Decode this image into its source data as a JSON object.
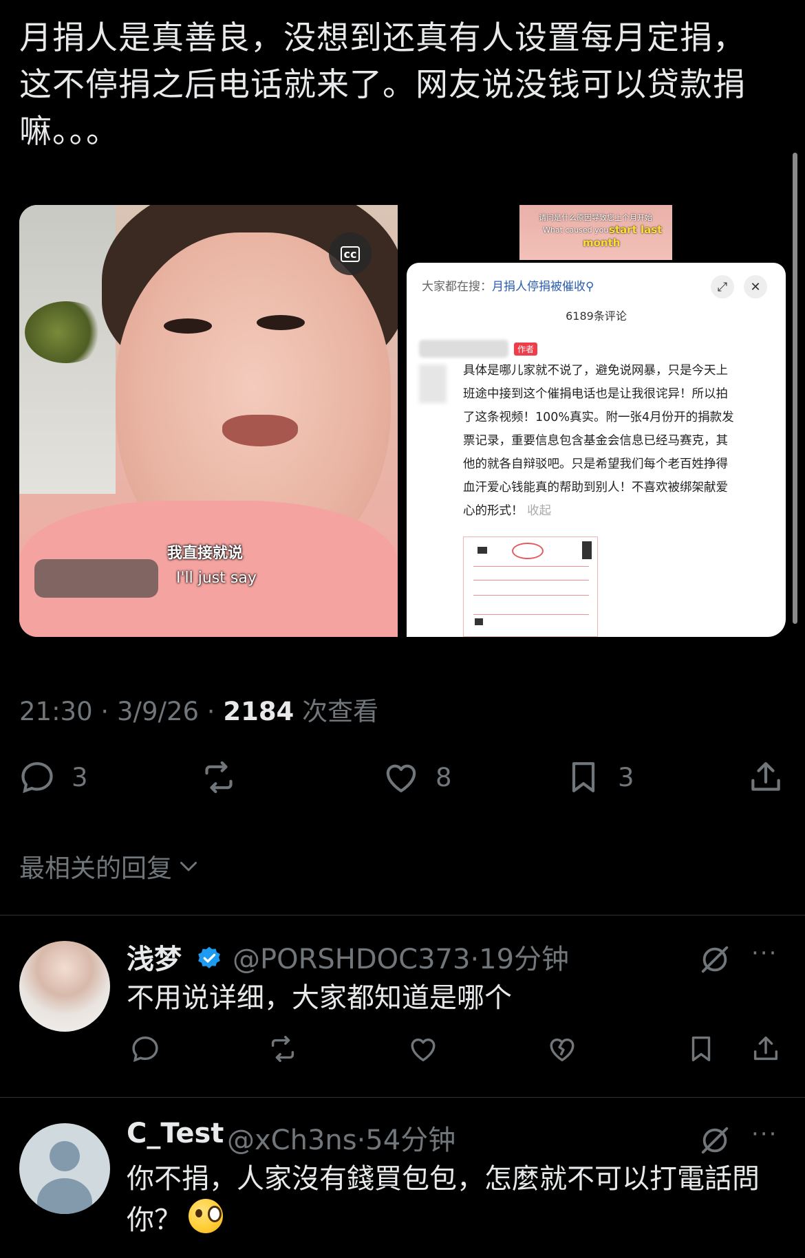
{
  "tweet": {
    "text": "月捐人是真善良，没想到还真有人设置每月定捐，这不停捐之后电话就来了。网友说没钱可以贷款捐嘛。。。",
    "media": {
      "video": {
        "cc_label": "cc",
        "subtitle_cn": "我直接就说",
        "subtitle_en": "I'll just say"
      },
      "thumb": {
        "line1": "请问是什么原因导致您上个月开始",
        "line2": "What caused you to",
        "line3": "start last",
        "line4": "month"
      },
      "panel": {
        "search_prefix": "大家都在搜：",
        "search_keyword": "月捐人停捐被催收",
        "search_icon_glyph": "⚲",
        "expand_icon_glyph": "⤢",
        "close_icon_glyph": "✕",
        "comment_count": "6189条评论",
        "author_tag": "作者",
        "comment": "具体是哪儿家就不说了，避免说网暴，只是今天上班途中接到这个催捐电话也是让我很诧异！所以拍了这条视频！100%真实。附一张4月份开的捐款发票记录，重要信息包含基金会信息已经马赛克，其他的就各自辩驳吧。只是希望我们每个老百姓挣得血汗爱心钱能真的帮助到别人！不喜欢被绑架献爱心的形式！",
        "collapse": "收起"
      }
    },
    "meta": {
      "time": "21:30",
      "sep": " · ",
      "date": "3/9/26",
      "views": "2184",
      "views_label": " 次查看"
    },
    "actions": {
      "replies": "3",
      "likes": "8",
      "bookmarks": "3"
    },
    "sort_label": "最相关的回复"
  },
  "replies": [
    {
      "name": "浅梦",
      "handle": "@PORSHDOC373",
      "time": "·19分钟",
      "text": "不用说详细，大家都知道是哪个",
      "verified": true,
      "more": "···"
    },
    {
      "name": "C_Test",
      "handle": "@xCh3ns",
      "time": "·54分钟",
      "text": "你不捐，人家沒有錢買包包，怎麼就不可以打電話問你？",
      "verified": false,
      "more": "···"
    }
  ],
  "colors": {
    "background": "#000000",
    "text": "#e7e9ea",
    "secondary": "#71767b",
    "verified": "#1d9bf0",
    "divider": "#2f3336"
  }
}
